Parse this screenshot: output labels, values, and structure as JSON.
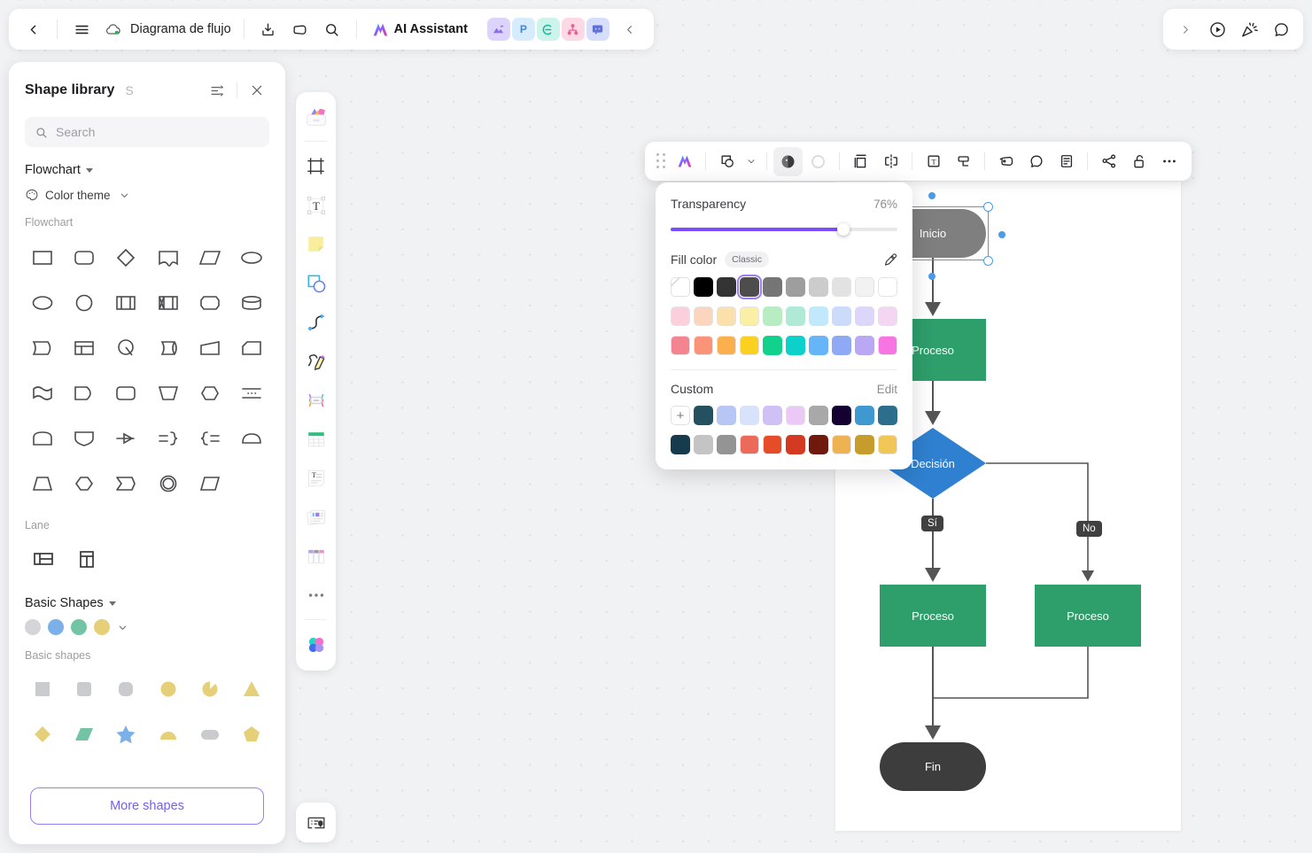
{
  "topbar": {
    "back_label": "Back",
    "menu_label": "Menu",
    "doc_title": "Diagrama de flujo",
    "download_label": "Download",
    "tag_label": "Tag",
    "search_label": "Search",
    "ai_label": "AI Assistant",
    "collapse_label": "Collapse",
    "apps": [
      {
        "name": "image-app",
        "glyph": "",
        "bg": "#ddd4fb",
        "fg": "#8b6ee8"
      },
      {
        "name": "presentation-app",
        "glyph": "P",
        "bg": "#d6ecfd",
        "fg": "#3f86d6"
      },
      {
        "name": "mindmap-app",
        "glyph": "",
        "bg": "#cdf4ec",
        "fg": "#16b79a"
      },
      {
        "name": "orgchart-app",
        "glyph": "",
        "bg": "#fcd9e4",
        "fg": "#e8638d"
      },
      {
        "name": "comment-app",
        "glyph": "",
        "bg": "#d7defb",
        "fg": "#5b72e0"
      }
    ]
  },
  "topright": {
    "expand_label": "Expand",
    "present_label": "Present",
    "celebrate_label": "Celebrate",
    "comment_label": "Comment"
  },
  "panel": {
    "title": "Shape library",
    "shortcut": "S",
    "sort_label": "Sort",
    "close_label": "Close",
    "search": {
      "placeholder": "Search",
      "value": ""
    },
    "category": "Flowchart",
    "color_theme": "Color theme",
    "group_flowchart": "Flowchart",
    "group_lane": "Lane",
    "basic_shapes_select": "Basic Shapes",
    "group_basic_shapes": "Basic shapes",
    "more_shapes": "More shapes",
    "flowchart_shapes": [
      "rectangle",
      "rounded-rectangle",
      "diamond",
      "callout-banner",
      "parallelogram",
      "oval-wide",
      "ellipse",
      "circle",
      "predefined-process",
      "internal-storage",
      "terminator-flat",
      "database",
      "curved-left-card",
      "table-card",
      "manual-operation-q",
      "direct-data",
      "trapezoid-right",
      "cut-corner-note",
      "document",
      "delay",
      "stadium-hexagon",
      "manual-input-trapezoid",
      "hexagon",
      "dashed-divider",
      "dome-top",
      "shield-down",
      "arrow-marker",
      "merge-right-brace",
      "split-left-brace",
      "half-dome",
      "trapezoid-down",
      "hexagon-tall",
      "chevron-flag",
      "double-circle",
      "skewed-rect"
    ],
    "lane_shapes": [
      "horizontal-lane",
      "vertical-lane"
    ],
    "theme_dots": [
      "#d3d5d8",
      "#7cb0e8",
      "#72c4a4",
      "#e5cf78"
    ],
    "basic_shape_items": [
      {
        "name": "square",
        "fill": "#c9cbce"
      },
      {
        "name": "rounded-square",
        "fill": "#c9cbce"
      },
      {
        "name": "rounded-square-lg",
        "fill": "#c9cbce"
      },
      {
        "name": "circle",
        "fill": "#e5cf78"
      },
      {
        "name": "pie",
        "fill": "#e5cf78"
      },
      {
        "name": "triangle",
        "fill": "#e5cf78"
      },
      {
        "name": "diamond",
        "fill": "#e5cf78"
      },
      {
        "name": "parallelogram",
        "fill": "#72c4a4"
      },
      {
        "name": "star",
        "fill": "#7cb0e8"
      },
      {
        "name": "semicircle",
        "fill": "#e5cf78"
      },
      {
        "name": "pill",
        "fill": "#c9cbce"
      },
      {
        "name": "pentagon",
        "fill": "#e5cf78"
      }
    ]
  },
  "rail": {
    "items": [
      "shape-library-tool",
      "frame-tool",
      "text-tool",
      "sticky-note-tool",
      "shapes-tool",
      "connector-tool",
      "pen-tool",
      "table-connector-tool",
      "table-tool",
      "text-card-tool",
      "card-stack-tool",
      "kanban-tool",
      "more-tools"
    ],
    "color_tool": "color-palette-tool",
    "bottom_tool": "presentation-frame-tool"
  },
  "shapebar": {
    "drag_label": "Drag handle",
    "items": [
      "ai-sparkle-icon",
      "shape-swap-icon",
      "chevron-down-icon",
      "fill-color-icon",
      "line-color-icon",
      "layout-icon",
      "flip-icon",
      "text-format-icon",
      "edge-style-icon",
      "tag-icon",
      "comment-bubble-icon",
      "note-icon",
      "connect-icon",
      "lock-icon",
      "more-options-icon"
    ]
  },
  "colorpop": {
    "transparency_label": "Transparency",
    "transparency_value": "76%",
    "transparency_percent": 76,
    "fill_label": "Fill color",
    "classic_label": "Classic",
    "eyedropper_label": "Pick color",
    "custom_label": "Custom",
    "edit_label": "Edit",
    "add_label": "+",
    "selected_index": 3,
    "classic_row1": [
      "none",
      "#000000",
      "#333333",
      "#4d4d4d",
      "#757575",
      "#9e9e9e",
      "#cccccc",
      "#e2e2e2",
      "#f2f2f2",
      "#ffffff"
    ],
    "classic_row2": [
      "#fbd0dc",
      "#fbd5bd",
      "#fbe0ab",
      "#fbefa5",
      "#b8edc3",
      "#b0ead6",
      "#c2e9fb",
      "#ccdbf9",
      "#ddd6fb",
      "#f5d6f2"
    ],
    "classic_row3": [
      "#f4848f",
      "#fb9378",
      "#fbb04e",
      "#fbd020",
      "#12d18c",
      "#0bd0cc",
      "#66b5f8",
      "#8fa9f6",
      "#bba8f4",
      "#f774e3"
    ],
    "custom_row1": [
      "#24505f",
      "#b7c6f4",
      "#d8e2fa",
      "#cfc0f6",
      "#ecc8f7",
      "#a8a8a8",
      "#140031",
      "#3f99d0",
      "#2c6e8c"
    ],
    "custom_row2": [
      "#163b4d",
      "#c4c4c4",
      "#949494",
      "#ec6a59",
      "#e74c28",
      "#d43a21",
      "#701a0e",
      "#eeb253",
      "#c69c2c",
      "#f0c757"
    ]
  },
  "flow": {
    "nodes": [
      {
        "id": "inicio",
        "label": "Inicio",
        "shape": "terminator",
        "fill": "#7f7f7f",
        "selected": true
      },
      {
        "id": "proc1",
        "label": "Proceso",
        "shape": "process",
        "fill": "#2e9e6b",
        "selected": false
      },
      {
        "id": "dec",
        "label": "Decisión",
        "shape": "decision",
        "fill": "#2f80d0",
        "selected": false
      },
      {
        "id": "proc2",
        "label": "Proceso",
        "shape": "process",
        "fill": "#2e9e6b",
        "selected": false
      },
      {
        "id": "proc3",
        "label": "Proceso",
        "shape": "process",
        "fill": "#2e9e6b",
        "selected": false
      },
      {
        "id": "fin",
        "label": "Fin",
        "shape": "terminator",
        "fill": "#3d3d3d",
        "selected": false
      }
    ],
    "edge_labels": [
      {
        "id": "yes",
        "label": "Sí"
      },
      {
        "id": "no",
        "label": "No"
      }
    ]
  }
}
